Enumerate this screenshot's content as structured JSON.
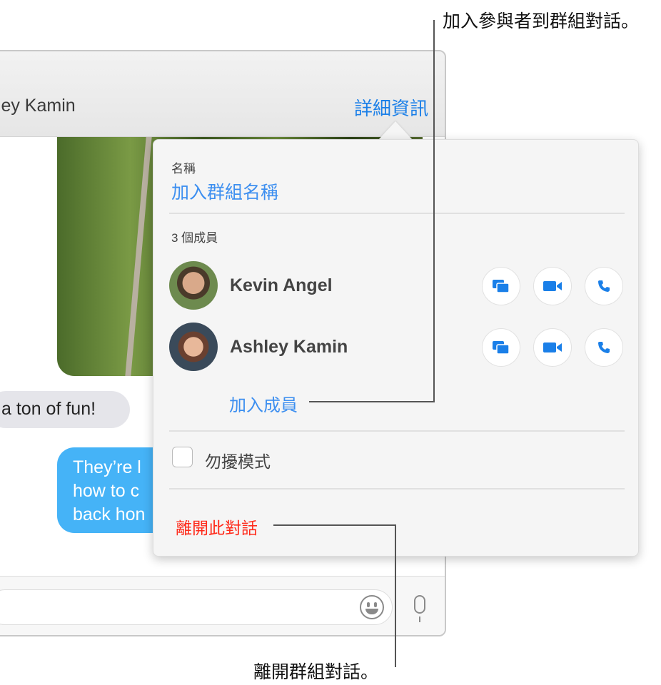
{
  "header": {
    "name": "hley Kamin",
    "details_label": "詳細資訊"
  },
  "messages": {
    "received": "a ton of fun!",
    "sent": [
      "They’re l",
      "how to c",
      "back hon"
    ]
  },
  "popover": {
    "name_label": "名稱",
    "add_group_name": "加入群組名稱",
    "members_label": "3 個成員",
    "members": [
      {
        "name": "Kevin Angel"
      },
      {
        "name": "Ashley Kamin"
      }
    ],
    "add_member": "加入成員",
    "dnd_label": "勿擾模式",
    "dnd_checked": false,
    "leave": "離開此對話"
  },
  "callouts": {
    "add": "加入參與者到群組對話。",
    "leave": "離開群組對話。"
  },
  "colors": {
    "accent": "#1a7fe8",
    "danger": "#ff2a1a",
    "sent_bubble": "#45b3f7"
  }
}
